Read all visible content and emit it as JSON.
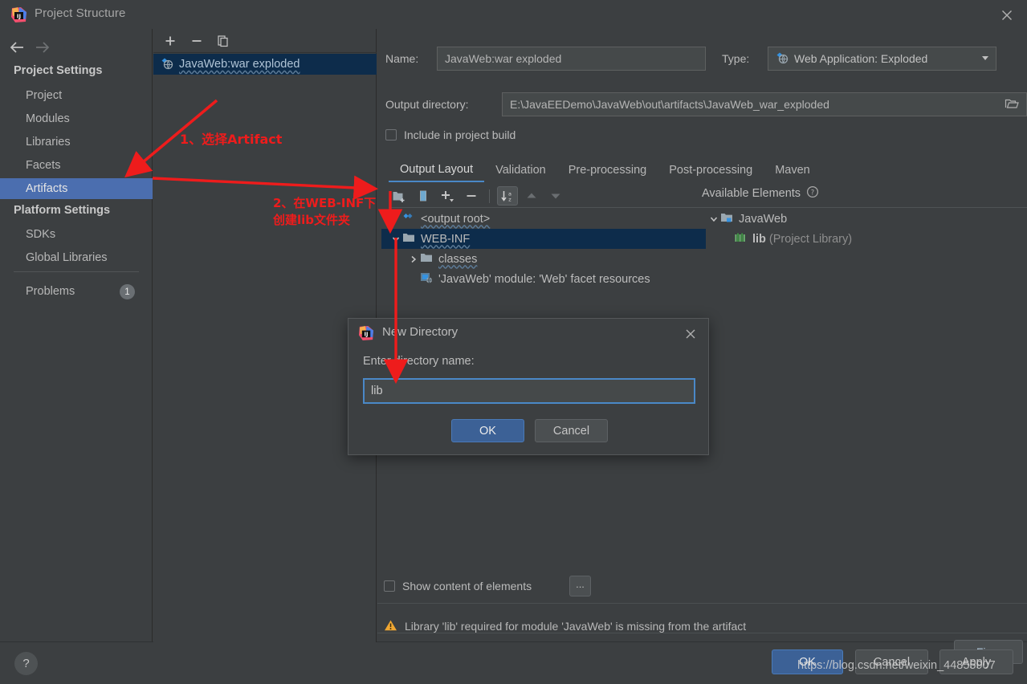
{
  "window": {
    "title": "Project Structure",
    "app_icon": "intellij-idea-icon",
    "close_icon": "close-icon"
  },
  "sidebar": {
    "back_icon": "arrow-left-icon",
    "forward_icon": "arrow-right-icon",
    "groups": [
      {
        "label": "Project Settings"
      },
      {
        "label": "Platform Settings"
      }
    ],
    "items": [
      {
        "label": "Project",
        "selected": false
      },
      {
        "label": "Modules",
        "selected": false
      },
      {
        "label": "Libraries",
        "selected": false
      },
      {
        "label": "Facets",
        "selected": false
      },
      {
        "label": "Artifacts",
        "selected": true
      },
      {
        "label": "SDKs",
        "selected": false
      },
      {
        "label": "Global Libraries",
        "selected": false
      },
      {
        "label": "Problems",
        "selected": false
      }
    ],
    "problems_count": "1",
    "help_label": "?",
    "selection_color": "#4b6eaf"
  },
  "artifact_list": {
    "toolbar": [
      {
        "name": "add-artifact-button",
        "icon": "plus-icon"
      },
      {
        "name": "remove-artifact-button",
        "icon": "minus-icon"
      },
      {
        "name": "copy-artifact-button",
        "icon": "copy-icon"
      }
    ],
    "items": [
      {
        "label": "JavaWeb:war exploded",
        "icon": "artifact-icon",
        "selected": true
      }
    ]
  },
  "detail": {
    "name_label": "Name:",
    "name_value": "JavaWeb:war exploded",
    "type_label": "Type:",
    "type_value": "Web Application: Exploded",
    "type_icon": "artifact-icon",
    "output_dir_label": "Output directory:",
    "output_dir_value": "E:\\JavaEEDemo\\JavaWeb\\out\\artifacts\\JavaWeb_war_exploded",
    "browse_icon": "folder-open-icon",
    "include_in_build_label": "Include in project build",
    "include_in_build_checked": false,
    "tabs": [
      {
        "label": "Output Layout",
        "active": true
      },
      {
        "label": "Validation",
        "active": false
      },
      {
        "label": "Pre-processing",
        "active": false
      },
      {
        "label": "Post-processing",
        "active": false
      },
      {
        "label": "Maven",
        "active": false
      }
    ],
    "layout_toolbar": [
      {
        "name": "create-directory-button",
        "icon": "new-folder-icon",
        "toggled": false
      },
      {
        "name": "create-archive-button",
        "icon": "archive-icon",
        "toggled": false
      },
      {
        "name": "add-element-button",
        "icon": "plus-dropdown-icon",
        "toggled": false
      },
      {
        "name": "remove-element-button",
        "icon": "minus-icon",
        "toggled": false
      },
      {
        "name": "sort-alphabetically-button",
        "icon": "sort-az-icon",
        "toggled": true
      },
      {
        "name": "move-up-button",
        "icon": "arrow-up-icon",
        "toggled": false
      },
      {
        "name": "move-down-button",
        "icon": "arrow-down-icon",
        "toggled": false
      }
    ],
    "output_tree": [
      {
        "label": "<output root>",
        "icon": "artifact-icon",
        "indent": 0,
        "twisty": "none",
        "selected": false,
        "wavy": true
      },
      {
        "label": "WEB-INF",
        "icon": "folder-icon",
        "indent": 1,
        "twisty": "expanded",
        "selected": true,
        "wavy": true
      },
      {
        "label": "classes",
        "icon": "folder-icon",
        "indent": 2,
        "twisty": "collapsed",
        "selected": false,
        "wavy": true
      },
      {
        "label": "'JavaWeb' module: 'Web' facet resources",
        "icon": "facet-icon",
        "indent": 2,
        "twisty": "none",
        "selected": false,
        "wavy": false
      }
    ],
    "available_elements_label": "Available Elements",
    "available_help_icon": "question-circle-icon",
    "available_tree": [
      {
        "label": "JavaWeb",
        "icon": "module-icon",
        "indent": 0,
        "twisty": "expanded",
        "suffix": ""
      },
      {
        "label": "lib",
        "icon": "library-icon",
        "indent": 1,
        "twisty": "none",
        "suffix": " (Project Library)"
      }
    ],
    "show_content_label": "Show content of elements",
    "show_content_checked": false,
    "ellipsis_label": "...",
    "warning_icon": "warning-triangle-icon",
    "warning_message": "Library 'lib' required for module 'JavaWeb' is missing from the artifact",
    "fix_label": "Fix..."
  },
  "actions": {
    "ok": "OK",
    "cancel": "Cancel",
    "apply": "Apply"
  },
  "modal": {
    "icon": "intellij-idea-icon",
    "title": "New Directory",
    "close_icon": "close-icon",
    "prompt": "Enter directory name:",
    "input_value": "lib",
    "ok": "OK",
    "cancel": "Cancel",
    "focus_border_color": "#4a88c7"
  },
  "annotations": {
    "color": "#ee1c1c",
    "note1": "1、选择Artifact",
    "note2": "2、在WEB-INF下\n创建lib文件夹"
  },
  "watermark": "https://blog.csdn.net/weixin_44855907"
}
